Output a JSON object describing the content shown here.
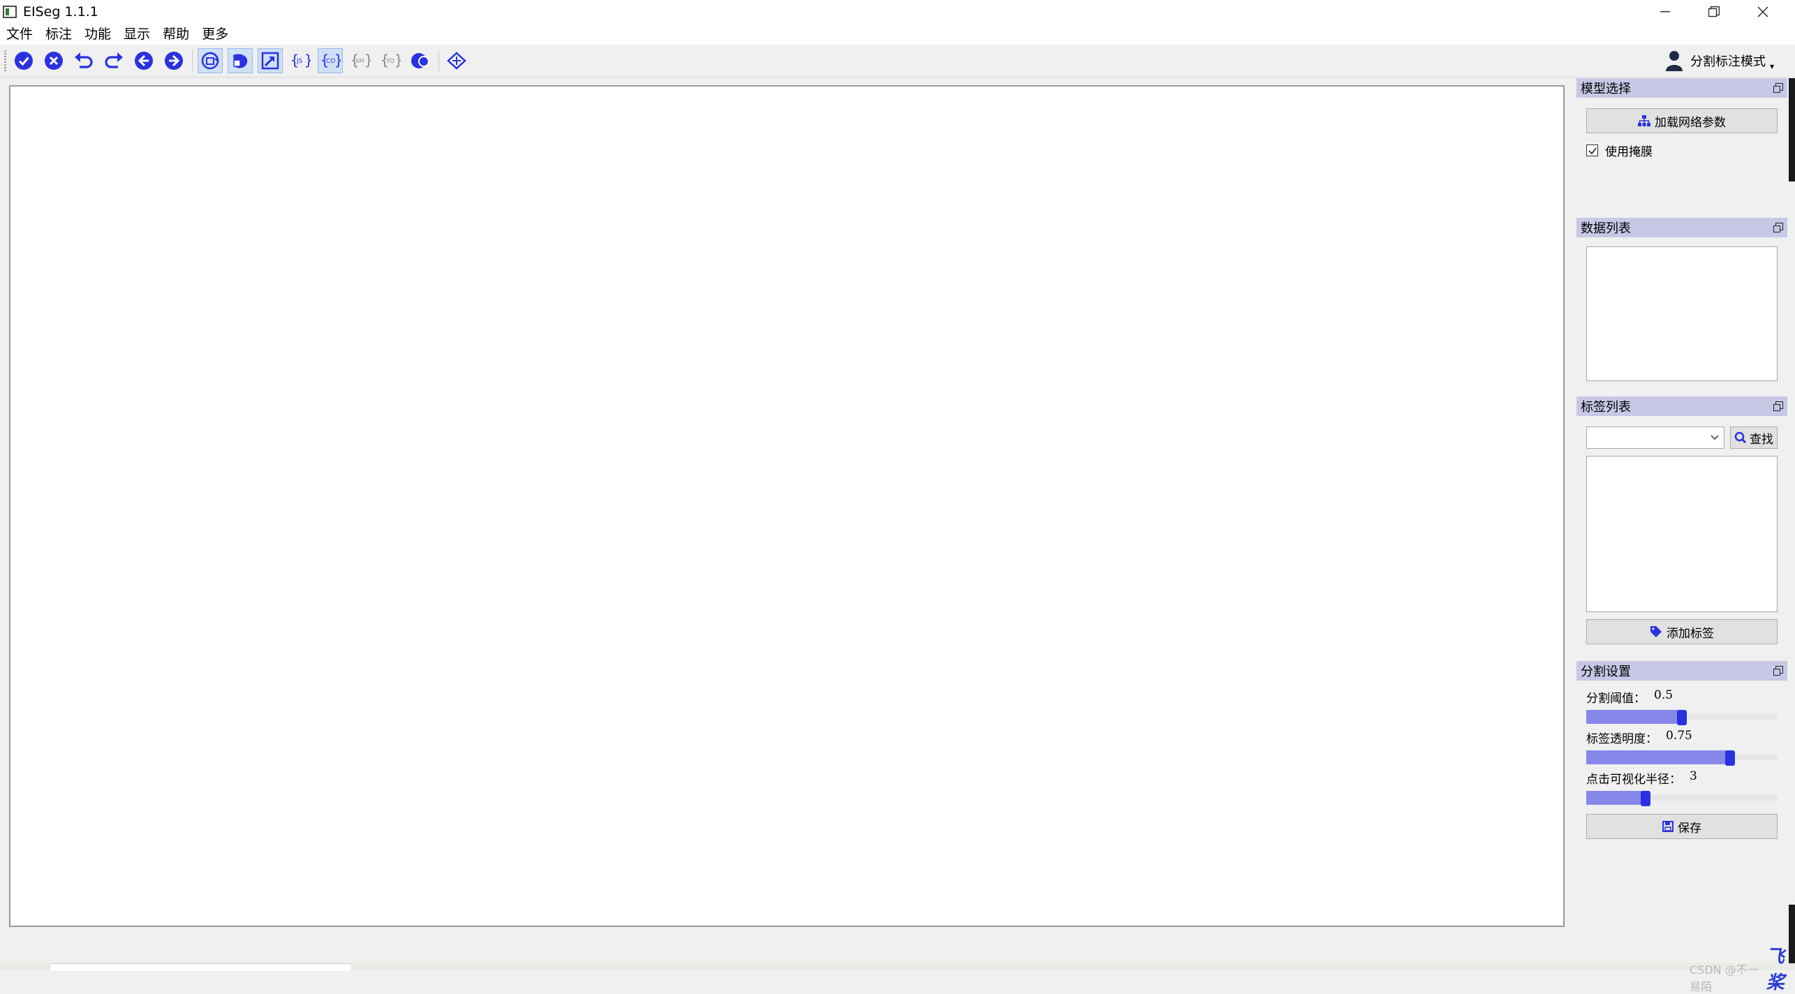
{
  "window": {
    "title": "EISeg 1.1.1",
    "controls": [
      "minimize-icon",
      "restore-icon",
      "close-icon"
    ]
  },
  "menu": [
    "文件",
    "标注",
    "功能",
    "显示",
    "帮助",
    "更多"
  ],
  "toolbar": {
    "buttons": [
      {
        "icon": "check-circle-icon",
        "checked": false
      },
      {
        "icon": "cancel-circle-icon",
        "checked": false
      },
      {
        "icon": "undo-icon",
        "checked": false
      },
      {
        "icon": "redo-icon",
        "checked": false
      },
      {
        "icon": "previous-image-icon",
        "checked": false
      },
      {
        "icon": "next-image-icon",
        "checked": false
      },
      {
        "icon": "auto-save-icon",
        "checked": true
      },
      {
        "icon": "save-mask-icon",
        "checked": true
      },
      {
        "icon": "save-label-icon",
        "checked": true
      },
      {
        "icon": "save-json-icon",
        "checked": false
      },
      {
        "icon": "save-coco-icon",
        "checked": true
      },
      {
        "icon": "save-xml-icon",
        "checked": false
      },
      {
        "icon": "save-yolo-icon",
        "checked": false
      },
      {
        "icon": "use-last-model-icon",
        "checked": false
      },
      {
        "icon": "grid-label-icon",
        "checked": false
      }
    ],
    "mode_label": "分割标注模式",
    "accent": "#2a32e0"
  },
  "docks": {
    "model": {
      "title": "模型选择",
      "load_button": "加载网络参数",
      "use_mask_label": "使用掩膜",
      "use_mask_checked": true
    },
    "data_list": {
      "title": "数据列表"
    },
    "label_list": {
      "title": "标签列表",
      "search_button": "查找",
      "search_value": "",
      "add_button": "添加标签"
    },
    "seg_settings": {
      "title": "分割设置",
      "threshold_label": "分割阈值：",
      "threshold_value": "0.5",
      "threshold_level": 0.5,
      "opacity_label": "标签透明度：",
      "opacity_value": "0.75",
      "opacity_level": 0.75,
      "radius_label": "点击可视化半径：",
      "radius_value": "3",
      "radius_level": 0.31,
      "save_button": "保存"
    },
    "header_color": "#c7c7e6"
  },
  "watermark": {
    "csdn": "CSDN @不一易陌",
    "logo": "飞桨"
  }
}
